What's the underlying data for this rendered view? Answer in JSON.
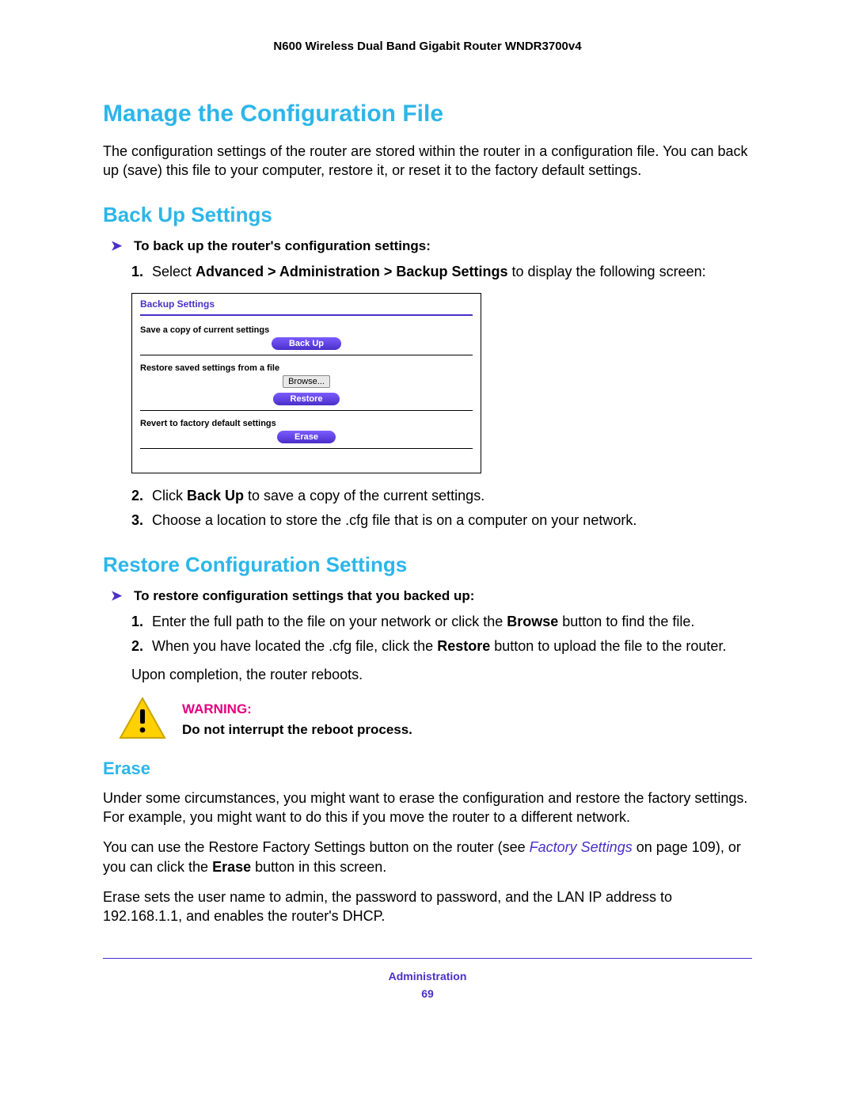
{
  "header": {
    "product": "N600 Wireless Dual Band Gigabit Router WNDR3700v4"
  },
  "h1": "Manage the Configuration File",
  "intro": "The configuration settings of the router are stored within the router in a configuration file. You can back up (save) this file to your computer, restore it, or reset it to the factory default settings.",
  "backup": {
    "title": "Back Up Settings",
    "proc": "To back up the router's configuration settings:",
    "steps": {
      "s1_pre": "Select ",
      "s1_bold": "Advanced > Administration > Backup Settings",
      "s1_post": " to display the following screen:",
      "s2_pre": "Click ",
      "s2_bold": "Back Up",
      "s2_post": " to save a copy of the current settings.",
      "s3": "Choose a location to store the .cfg file that is on a computer on your network."
    }
  },
  "panel": {
    "title": "Backup Settings",
    "save_label": "Save a copy of current settings",
    "backup_btn": "Back Up",
    "restore_label": "Restore saved settings from a file",
    "browse_btn": "Browse...",
    "restore_btn": "Restore",
    "revert_label": "Revert to factory default settings",
    "erase_btn": "Erase"
  },
  "restore": {
    "title": "Restore Configuration Settings",
    "proc": "To restore configuration settings that you backed up:",
    "steps": {
      "s1_pre": "Enter the full path to the file on your network or click the ",
      "s1_bold": "Browse",
      "s1_post": " button to find the file.",
      "s2_pre": "When you have located the .cfg file, click the ",
      "s2_bold": "Restore",
      "s2_post": " button to upload the file to the router."
    },
    "after": "Upon completion, the router reboots."
  },
  "warning": {
    "label": "WARNING:",
    "msg": "Do not interrupt the reboot process."
  },
  "erase": {
    "title": "Erase",
    "p1": "Under some circumstances, you might want to erase the configuration and restore the factory settings. For example, you might want to do this if you move the router to a different network.",
    "p2_pre": "You can use the Restore Factory Settings button on the router (see ",
    "p2_link": "Factory Settings",
    "p2_mid": " on page 109), or you can click the ",
    "p2_bold": "Erase",
    "p2_post": " button in this screen.",
    "p3": "Erase sets the user name to admin, the password to password, and the LAN IP address to 192.168.1.1, and enables the router's DHCP."
  },
  "footer": {
    "chapter": "Administration",
    "page": "69"
  }
}
